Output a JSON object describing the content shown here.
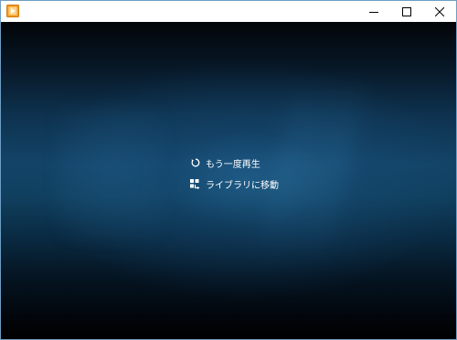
{
  "titlebar": {
    "app_icon": "media-player-app-icon",
    "controls": [
      "minimize-icon",
      "maximize-icon",
      "close-icon"
    ]
  },
  "actions": [
    {
      "icon": "replay-icon",
      "label": "もう一度再生"
    },
    {
      "icon": "library-icon",
      "label": "ライブラリに移動"
    }
  ],
  "colors": {
    "accent": "#f0a020",
    "border": "#6f9ec4",
    "text": "#ffffff",
    "background_glow": "#134468"
  }
}
